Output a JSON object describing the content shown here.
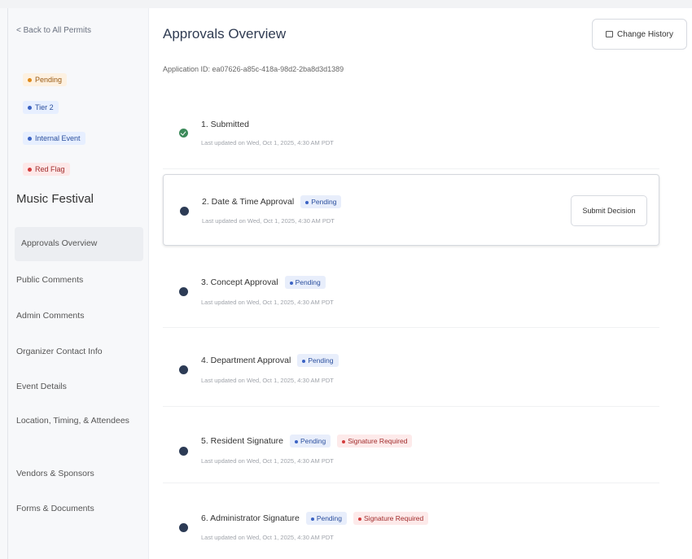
{
  "sidebar": {
    "back_label": "< Back to All Permits",
    "tags": [
      {
        "label": "Pending",
        "color": "#e08a1a"
      },
      {
        "label": "Tier 2",
        "color": "#3b63c4"
      },
      {
        "label": "Internal Event",
        "color": "#3b63c4"
      },
      {
        "label": "Red Flag",
        "color": "#d33c3c"
      }
    ],
    "event_name": "Music Festival",
    "nav": [
      {
        "label": "Approvals Overview",
        "active": true
      },
      {
        "label": "Public Comments"
      },
      {
        "label": "Admin Comments"
      },
      {
        "label": "Organizer Contact Info"
      },
      {
        "label": "Event Details"
      },
      {
        "label": "Location, Timing, & Attendees"
      },
      {
        "label": "Vendors & Sponsors"
      },
      {
        "label": "Forms & Documents"
      }
    ]
  },
  "main": {
    "title": "Approvals Overview",
    "application_id": "Application ID: ea07626-a85c-418a-98d2-2ba8d3d1389",
    "change_history_label": "Change History",
    "submit_decision_label": "Submit Decision",
    "steps": [
      {
        "title": "1. Submitted",
        "status": "done",
        "badges": [],
        "updated": "Last updated on Wed, Oct 1, 2025, 4:30 AM PDT"
      },
      {
        "title": "2. Date & Time Approval",
        "status": "pending",
        "badges": [
          "Pending"
        ],
        "updated": "Last updated on Wed, Oct 1, 2025, 4:30 AM PDT"
      },
      {
        "title": "3. Concept Approval",
        "status": "pending",
        "badges": [
          "Pending"
        ],
        "updated": "Last updated on Wed, Oct 1, 2025, 4:30 AM PDT"
      },
      {
        "title": "4. Department Approval",
        "status": "pending",
        "badges": [
          "Pending"
        ],
        "updated": "Last updated on Wed, Oct 1, 2025, 4:30 AM PDT"
      },
      {
        "title": "5. Resident Signature",
        "status": "pending",
        "badges": [
          "Pending",
          "Signature Required"
        ],
        "updated": "Last updated on Wed, Oct 1, 2025, 4:30 AM PDT"
      },
      {
        "title": "6. Administrator Signature",
        "status": "pending",
        "badges": [
          "Pending",
          "Signature Required"
        ],
        "updated": "Last updated on Wed, Oct 1, 2025, 4:30 AM PDT"
      }
    ]
  }
}
